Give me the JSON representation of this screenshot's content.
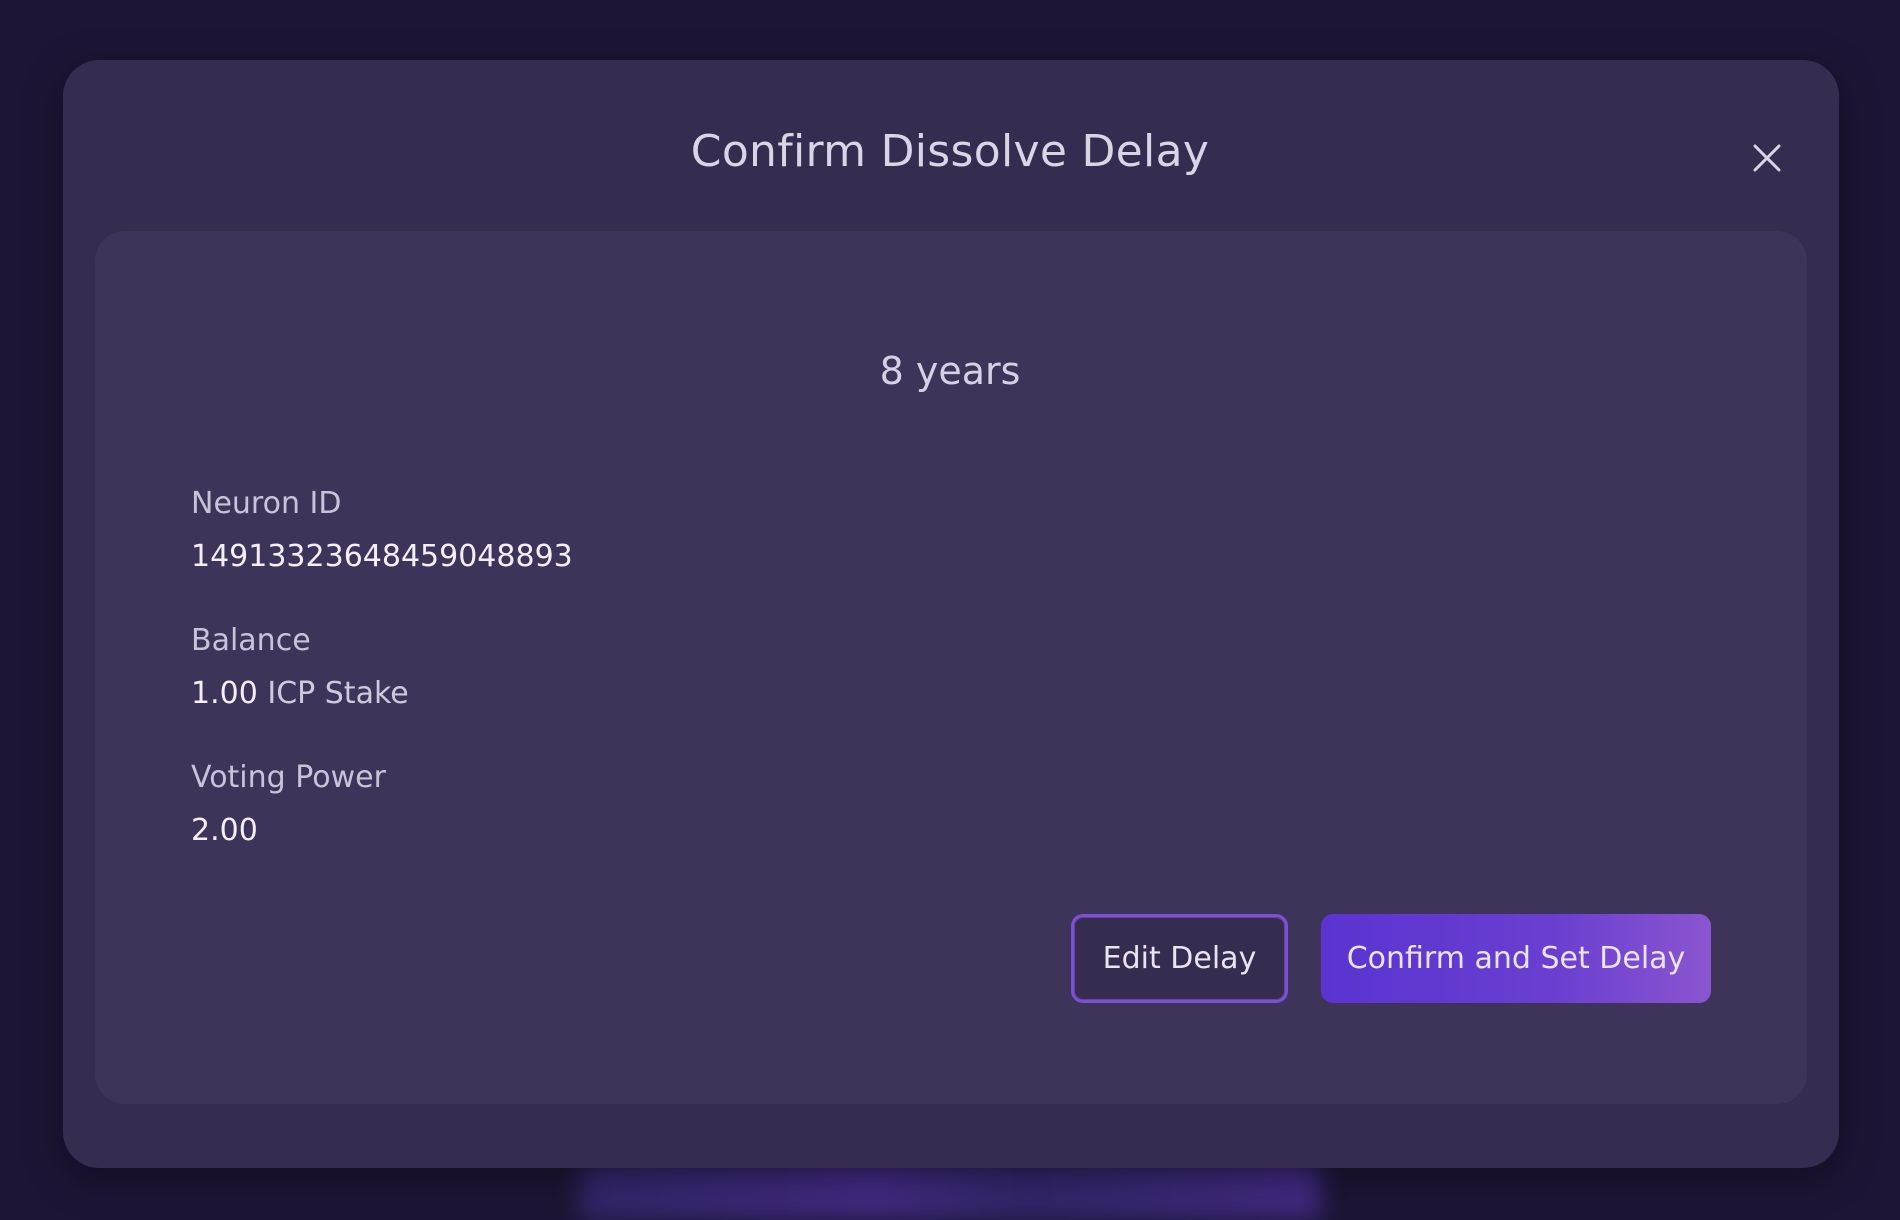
{
  "modal": {
    "title": "Confirm Dissolve Delay",
    "close_icon": "close-icon"
  },
  "delay": {
    "value": "8 years"
  },
  "fields": {
    "neuron_id_label": "Neuron ID",
    "neuron_id_value": "14913323648459048893",
    "balance_label": "Balance",
    "balance_amount": "1.00",
    "balance_unit": "ICP Stake",
    "voting_power_label": "Voting Power",
    "voting_power_value": "2.00"
  },
  "actions": {
    "edit_label": "Edit Delay",
    "confirm_label": "Confirm and Set Delay"
  },
  "colors": {
    "background": "#1d1535",
    "modal": "#352c50",
    "card": "#3e3359",
    "accent": "#5a33d1"
  }
}
